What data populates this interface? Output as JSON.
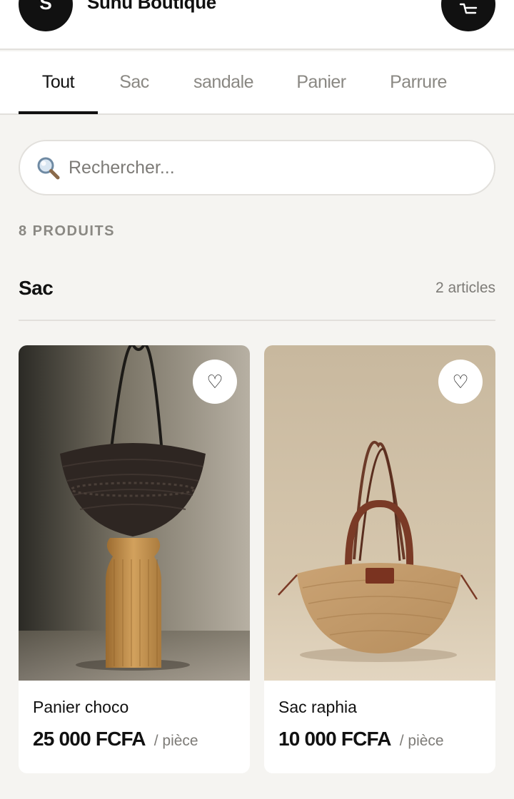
{
  "header": {
    "logo_letter": "S",
    "brand_name": "Sunu Boutique",
    "cart_icon": "cart-icon"
  },
  "tabs": [
    {
      "label": "Tout",
      "active": true
    },
    {
      "label": "Sac",
      "active": false
    },
    {
      "label": "sandale",
      "active": false
    },
    {
      "label": "Panier",
      "active": false
    },
    {
      "label": "Parrure",
      "active": false
    }
  ],
  "search": {
    "placeholder": "Rechercher...",
    "value": "",
    "icon": "search-icon"
  },
  "product_count": "8 PRODUITS",
  "section": {
    "title": "Sac",
    "count": "2 articles"
  },
  "products": [
    {
      "name": "Panier choco",
      "price": "25 000 FCFA",
      "unit": "/ pièce",
      "favorite_icon": "heart-icon"
    },
    {
      "name": "Sac raphia",
      "price": "10 000 FCFA",
      "unit": "/ pièce",
      "favorite_icon": "heart-icon"
    }
  ],
  "colors": {
    "accent": "#111111",
    "background": "#f5f4f1",
    "muted_text": "#8a8883",
    "border": "#e2e0dc"
  }
}
